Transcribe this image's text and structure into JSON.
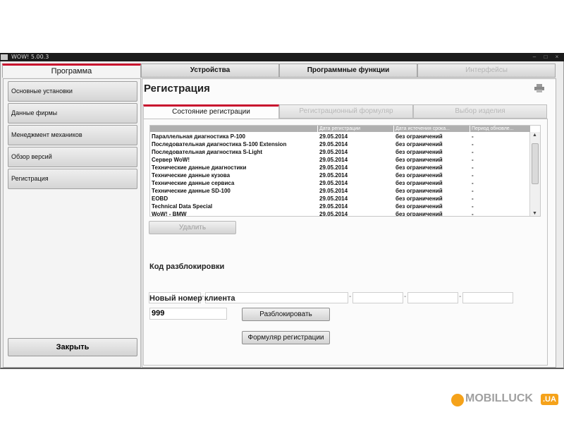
{
  "window": {
    "title": "WOW! 5.00.3"
  },
  "top_tabs": [
    {
      "label": "Программа"
    },
    {
      "label": "Устройства"
    },
    {
      "label": "Программные функции"
    },
    {
      "label": "Интерфейсы"
    }
  ],
  "sidebar": {
    "items": [
      {
        "label": "Основные установки"
      },
      {
        "label": "Данные фирмы"
      },
      {
        "label": "Менеджмент механиков"
      },
      {
        "label": "Обзор версий"
      },
      {
        "label": "Регистрация"
      }
    ],
    "close_label": "Закрыть"
  },
  "main": {
    "title": "Регистрация",
    "sub_tabs": [
      {
        "label": "Состояние регистрации"
      },
      {
        "label": "Регистрационный формуляр"
      },
      {
        "label": "Выбор изделия"
      }
    ],
    "table": {
      "columns": [
        "",
        "Дата регистрации",
        "Дата истечения срока...",
        "Период обновле..."
      ],
      "rows": [
        [
          "Параллельная диагностика P-100",
          "29.05.2014",
          "без ограничений",
          "-"
        ],
        [
          "Последовательная диагностика S-100 Extension",
          "29.05.2014",
          "без ограничений",
          "-"
        ],
        [
          "Последовательная диагностика S-Light",
          "29.05.2014",
          "без ограничений",
          "-"
        ],
        [
          "Сервер WoW!",
          "29.05.2014",
          "без ограничений",
          "-"
        ],
        [
          "Технические данные диагностики",
          "29.05.2014",
          "без ограничений",
          "-"
        ],
        [
          "Технические данные кузова",
          "29.05.2014",
          "без ограничений",
          "-"
        ],
        [
          "Технические данные сервиса",
          "29.05.2014",
          "без ограничений",
          "-"
        ],
        [
          "Технические данные SD-100",
          "29.05.2014",
          "без ограничений",
          "-"
        ],
        [
          "EOBD",
          "29.05.2014",
          "без ограничений",
          "-"
        ],
        [
          "Technical Data Special",
          "29.05.2014",
          "без ограничений",
          "-"
        ],
        [
          "WoW! - BMW",
          "29.05.2014",
          "без ограничений",
          "-"
        ]
      ]
    },
    "delete_label": "Удалить",
    "unlock_code_label": "Код разблокировки",
    "unlock_code_separators": [
      "-",
      "-",
      "-",
      "-"
    ],
    "client_number_label": "Новый номер клиента",
    "client_number_value": "999",
    "unlock_button_label": "Разблокировать",
    "registration_form_button_label": "Формуляр регистрации"
  },
  "watermark": {
    "text": "MOBILLUCK",
    "badge": ".UA"
  },
  "colors": {
    "accent": "#c8102e",
    "watermark_orange": "#f5a21a"
  }
}
